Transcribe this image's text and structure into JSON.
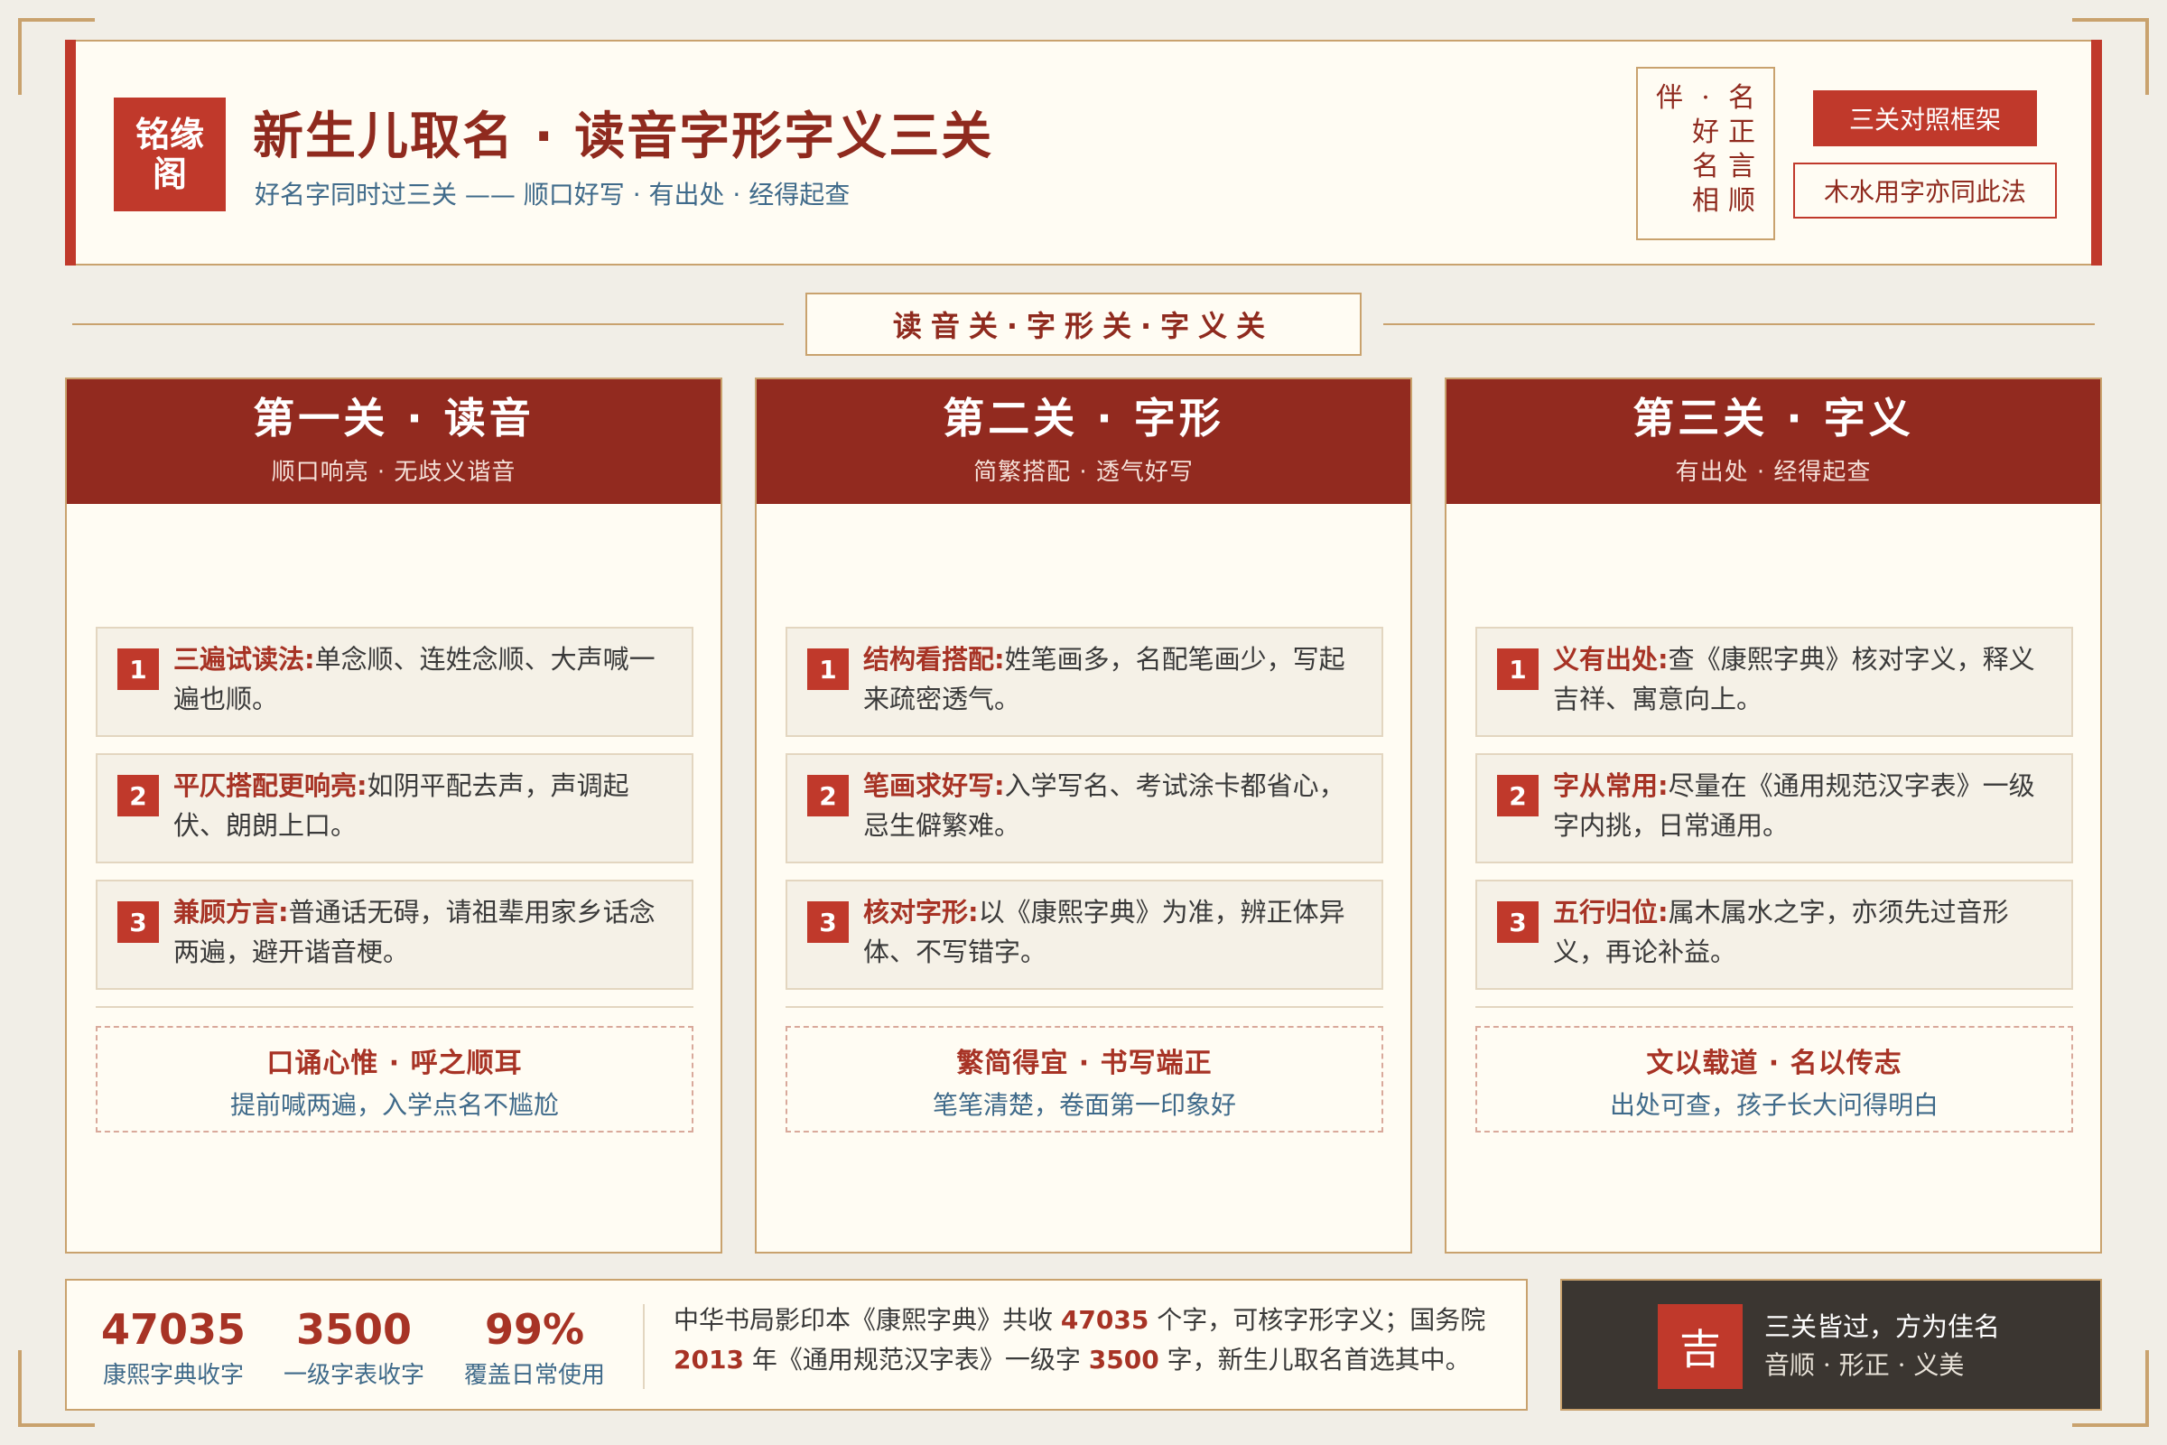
{
  "header": {
    "logo_line1": "铭缘",
    "logo_line2": "阁",
    "title": "新生儿取名 · 读音字形字义三关",
    "subtitle": "好名字同时过三关 —— 顺口好写 · 有出处 · 经得起查",
    "seal_columns": [
      [
        "名",
        "正",
        "言",
        "顺"
      ],
      [
        "·",
        "好",
        "名",
        "相"
      ],
      [
        "伴"
      ]
    ],
    "primary_button": "三关对照框架",
    "secondary_button": "木水用字亦同此法"
  },
  "banner": "读音关·字形关·字义关",
  "cards": [
    {
      "title": "第一关 · 读音",
      "subtitle": "顺口响亮 · 无歧义谐音",
      "items": [
        {
          "num": "1",
          "key": "三遍试读法:",
          "text": "单念顺、连姓念顺、大声喊一遍也顺。"
        },
        {
          "num": "2",
          "key": "平仄搭配更响亮:",
          "text": "如阴平配去声，声调起伏、朗朗上口。"
        },
        {
          "num": "3",
          "key": "兼顾方言:",
          "text": "普通话无碍，请祖辈用家乡话念两遍，避开谐音梗。"
        }
      ],
      "motto_title": "口诵心惟 · 呼之顺耳",
      "motto_sub": "提前喊两遍，入学点名不尴尬"
    },
    {
      "title": "第二关 · 字形",
      "subtitle": "简繁搭配 · 透气好写",
      "items": [
        {
          "num": "1",
          "key": "结构看搭配:",
          "text": "姓笔画多，名配笔画少，写起来疏密透气。"
        },
        {
          "num": "2",
          "key": "笔画求好写:",
          "text": "入学写名、考试涂卡都省心，忌生僻繁难。"
        },
        {
          "num": "3",
          "key": "核对字形:",
          "text": "以《康熙字典》为准，辨正体异体、不写错字。"
        }
      ],
      "motto_title": "繁简得宜 · 书写端正",
      "motto_sub": "笔笔清楚，卷面第一印象好"
    },
    {
      "title": "第三关 · 字义",
      "subtitle": "有出处 · 经得起查",
      "items": [
        {
          "num": "1",
          "key": "义有出处:",
          "text": "查《康熙字典》核对字义，释义吉祥、寓意向上。"
        },
        {
          "num": "2",
          "key": "字从常用:",
          "text": "尽量在《通用规范汉字表》一级字内挑，日常通用。"
        },
        {
          "num": "3",
          "key": "五行归位:",
          "text": "属木属水之字，亦须先过音形义，再论补益。"
        }
      ],
      "motto_title": "文以载道 · 名以传志",
      "motto_sub": "出处可查，孩子长大问得明白"
    }
  ],
  "stats": [
    {
      "value": "47035",
      "label": "康熙字典收字"
    },
    {
      "value": "3500",
      "label": "一级字表收字"
    },
    {
      "value": "99%",
      "label": "覆盖日常使用"
    }
  ],
  "stats_note": {
    "p1": "中华书局影印本《康熙字典》共收 ",
    "v1": "47035",
    "p2": " 个字，可核字形字义；国务院 ",
    "v2": "2013",
    "p3": " 年《通用规范汉字表》一级字 ",
    "v3": "3500",
    "p4": " 字，新生儿取名首选其中。"
  },
  "lucky": {
    "seal": "吉",
    "line1": "三关皆过，方为佳名",
    "line2": "音顺 · 形正 · 义美"
  },
  "colors": {
    "accent": "#c0392b",
    "header_red": "#922a1f",
    "gold": "#c9a26e",
    "blue_text": "#3f6a8a",
    "dark_panel": "#3b3631",
    "paper": "#fffcf3"
  }
}
